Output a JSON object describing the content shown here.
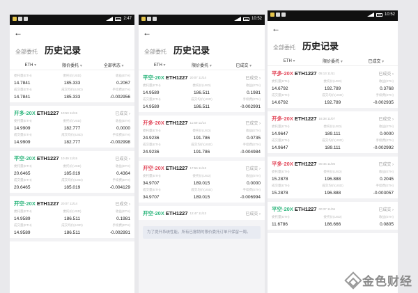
{
  "phones": [
    {
      "status_time": "2:47",
      "tab_all": "全部委托",
      "title": "历史记录",
      "columns": [
        "ETH",
        "限价委托",
        "全部状态"
      ],
      "partial_order": {
        "rows": [
          {
            "l1": "委托量(ETH)",
            "l2": "委托价(USD)",
            "l3": "收益(ETH)",
            "v1": "14.7841",
            "v2": "185.333",
            "v3": "0.2067"
          },
          {
            "l1": "成交量(ETH)",
            "l2": "成交均价(USD)",
            "l3": "手续费(ETH)",
            "v1": "14.7841",
            "v2": "185.333",
            "v3": "-0.002956"
          }
        ]
      },
      "orders": [
        {
          "side": "开多·20X",
          "side_color": "green",
          "symbol": "ETH1227",
          "time": "10:50 11/15",
          "status": "已成交",
          "rows": [
            {
              "l1": "委托量(ETH)",
              "l2": "委托价(USD)",
              "l3": "收益(ETH)",
              "v1": "14.9909",
              "v2": "182.777",
              "v3": "0.0000"
            },
            {
              "l1": "成交量(ETH)",
              "l2": "成交均价(USD)",
              "l3": "手续费(ETH)",
              "v1": "14.9909",
              "v2": "182.777",
              "v3": "-0.002998"
            }
          ]
        },
        {
          "side": "平空·20X",
          "side_color": "green",
          "symbol": "ETH1227",
          "time": "10:49 11/15",
          "status": "已成交",
          "rows": [
            {
              "l1": "委托量(ETH)",
              "l2": "委托价(USD)",
              "l3": "收益(ETH)",
              "v1": "20.6465",
              "v2": "185.019",
              "v3": "0.4364"
            },
            {
              "l1": "成交量(ETH)",
              "l2": "成交均价(USD)",
              "l3": "手续费(ETH)",
              "v1": "20.6465",
              "v2": "185.019",
              "v3": "-0.004129"
            }
          ]
        },
        {
          "side": "开空·20X",
          "side_color": "green",
          "symbol": "ETH1227",
          "time": "20:07 11/14",
          "status": "已成交",
          "rows": [
            {
              "l1": "委托量(ETH)",
              "l2": "委托价(USD)",
              "l3": "收益(ETH)",
              "v1": "14.9589",
              "v2": "186.511",
              "v3": "0.1981"
            },
            {
              "l1": "成交量(ETH)",
              "l2": "成交均价(USD)",
              "l3": "手续费(ETH)",
              "v1": "14.9589",
              "v2": "186.511",
              "v3": "-0.002991"
            }
          ]
        }
      ]
    },
    {
      "status_time": "10:52",
      "tab_all": "全部委托",
      "title": "历史记录",
      "columns": [
        "ETH",
        "限价委托",
        "已成交"
      ],
      "orders": [
        {
          "side": "平空·20X",
          "side_color": "green",
          "symbol": "ETH1227",
          "time": "20:07 11/14",
          "status": "已成交",
          "rows": [
            {
              "l1": "委托量(ETH)",
              "l2": "委托价(USD)",
              "l3": "收益(ETH)",
              "v1": "14.9589",
              "v2": "186.511",
              "v3": "0.1981"
            },
            {
              "l1": "成交量(ETH)",
              "l2": "成交均价(USD)",
              "l3": "手续费(ETH)",
              "v1": "14.9589",
              "v2": "186.511",
              "v3": "-0.002991"
            }
          ]
        },
        {
          "side": "开多·20X",
          "side_color": "red",
          "symbol": "ETH1227",
          "time": "11:59 11/14",
          "status": "已成交",
          "rows": [
            {
              "l1": "委托量(ETH)",
              "l2": "委托价(USD)",
              "l3": "收益(ETH)",
              "v1": "24.9236",
              "v2": "191.786",
              "v3": "0.0735"
            },
            {
              "l1": "成交量(ETH)",
              "l2": "成交均价(USD)",
              "l3": "手续费(ETH)",
              "v1": "24.9236",
              "v2": "191.786",
              "v3": "-0.004984"
            }
          ]
        },
        {
          "side": "开空·20X",
          "side_color": "red",
          "symbol": "ETH1227",
          "time": "17:56 11/13",
          "status": "已成交",
          "rows": [
            {
              "l1": "委托量(ETH)",
              "l2": "委托价(USD)",
              "l3": "收益(ETH)",
              "v1": "34.9707",
              "v2": "189.015",
              "v3": "0.0000"
            },
            {
              "l1": "成交量(ETH)",
              "l2": "成交均价(USD)",
              "l3": "手续费(ETH)",
              "v1": "34.9707",
              "v2": "189.015",
              "v3": "-0.006994"
            }
          ]
        },
        {
          "side": "开空·20X",
          "side_color": "green",
          "symbol": "ETH1227",
          "time": "12:47 11/13",
          "status": "已成交",
          "rows": []
        }
      ],
      "notice": "为了提升系统性能，所有已撤销的限价委托订单只保留一周。"
    },
    {
      "status_time": "10:52",
      "tab_all": "全部委托",
      "title": "历史记录",
      "columns": [
        "ETH",
        "限价委托",
        "已成交"
      ],
      "orders": [
        {
          "side": "平多·20X",
          "side_color": "red",
          "symbol": "ETH1227",
          "time": "05:13 11/11",
          "status": "已成交",
          "rows": [
            {
              "l1": "委托量(ETH)",
              "l2": "委托价(USD)",
              "l3": "收益(ETH)",
              "v1": "14.6792",
              "v2": "192.789",
              "v3": "0.3768"
            },
            {
              "l1": "成交量(ETH)",
              "l2": "成交均价(USD)",
              "l3": "手续费(ETH)",
              "v1": "14.6792",
              "v2": "192.789",
              "v3": "-0.002935"
            }
          ]
        },
        {
          "side": "开多·20X",
          "side_color": "red",
          "symbol": "ETH1227",
          "time": "16:38 11/07",
          "status": "已成交",
          "rows": [
            {
              "l1": "委托量(ETH)",
              "l2": "委托价(USD)",
              "l3": "收益(ETH)",
              "v1": "14.9647",
              "v2": "189.111",
              "v3": "0.0000"
            },
            {
              "l1": "成交量(ETH)",
              "l2": "成交均价(USD)",
              "l3": "手续费(ETH)",
              "v1": "14.9647",
              "v2": "189.111",
              "v3": "-0.002992"
            }
          ]
        },
        {
          "side": "平多·20X",
          "side_color": "red",
          "symbol": "ETH1227",
          "time": "00:46 11/06",
          "status": "已成交",
          "rows": [
            {
              "l1": "委托量(ETH)",
              "l2": "委托价(USD)",
              "l3": "收益(ETH)",
              "v1": "15.2878",
              "v2": "196.888",
              "v3": "0.2045"
            },
            {
              "l1": "成交量(ETH)",
              "l2": "成交均价(USD)",
              "l3": "手续费(ETH)",
              "v1": "15.2878",
              "v2": "196.888",
              "v3": "-0.003057"
            }
          ]
        },
        {
          "side": "平空·20X",
          "side_color": "green",
          "symbol": "ETH1227",
          "time": "00:37 11/06",
          "status": "已成交",
          "rows": [
            {
              "l1": "委托量(ETH)",
              "l2": "委托价(USD)",
              "l3": "收益(ETH)",
              "v1": "11.6786",
              "v2": "186.666",
              "v3": "0.0805"
            }
          ]
        }
      ]
    }
  ],
  "watermark": {
    "text": "金色财经"
  },
  "colors": {
    "green": "#2eb67d",
    "red": "#e2485a"
  }
}
